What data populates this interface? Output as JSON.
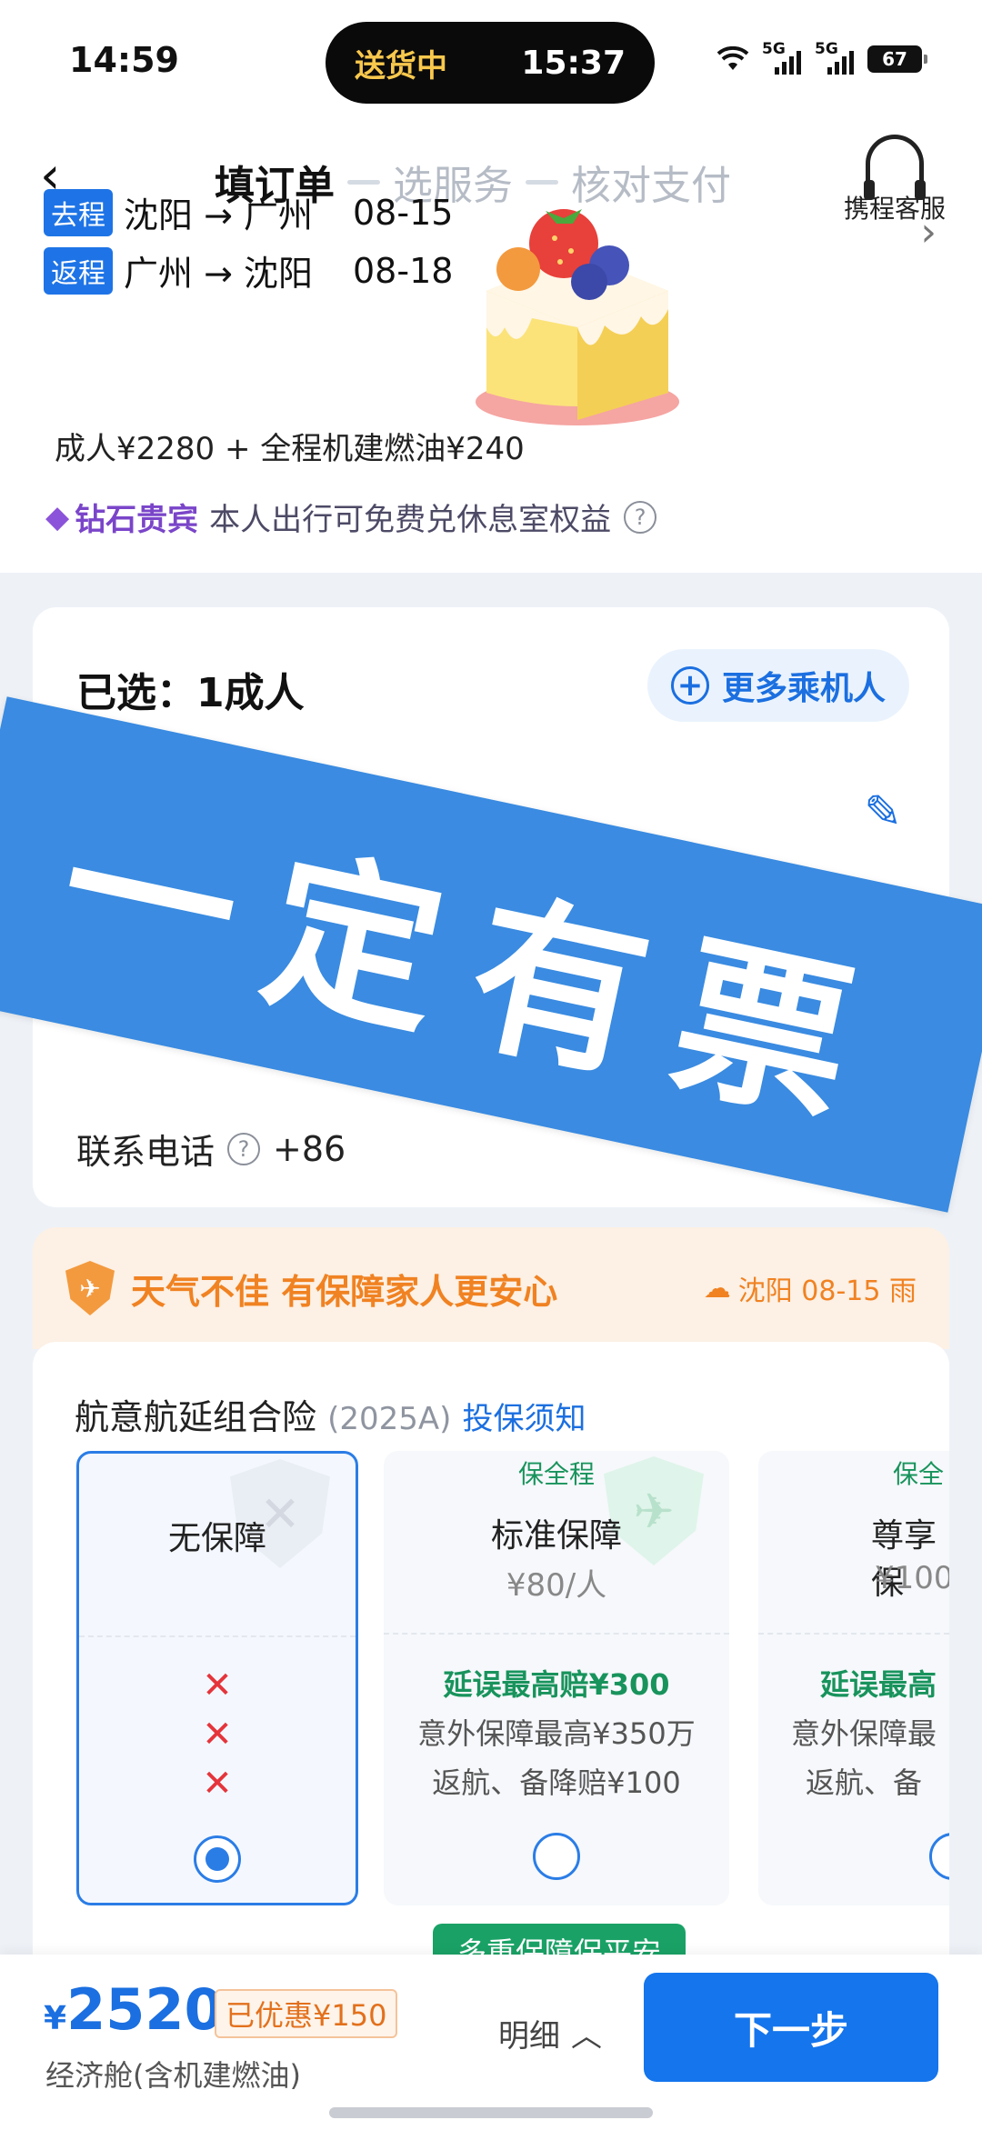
{
  "status_bar": {
    "time": "14:59",
    "island_label": "送货中",
    "island_time": "15:37",
    "battery": "67"
  },
  "header": {
    "steps": [
      "填订单",
      "选服务",
      "核对支付"
    ],
    "service_label": "携程客服"
  },
  "trips": [
    {
      "tag": "去程",
      "route": "沈阳 → 广州",
      "date": "08-15"
    },
    {
      "tag": "返程",
      "route": "广州 → 沈阳",
      "date": "08-18"
    }
  ],
  "price_line": "成人¥2280 + 全程机建燃油¥240",
  "vip": {
    "level": "钻石贵宾",
    "text": "本人出行可免费兑休息室权益"
  },
  "passenger": {
    "selected": "已选：1成人",
    "more_button": "更多乘机人",
    "phone_label": "联系电话",
    "phone_prefix": "+86"
  },
  "stamp_text": "一定有票",
  "weather": {
    "text": "天气不佳 有保障家人更安心",
    "right": "沈阳 08-15 雨"
  },
  "insurance": {
    "title": "航意航延组合险",
    "year": "(2025A)",
    "link": "投保须知",
    "options": [
      {
        "tag": "",
        "name": "无保障",
        "price": "",
        "lines": [
          "✕",
          "✕",
          "✕"
        ],
        "selected": true
      },
      {
        "tag": "保全程",
        "name": "标准保障",
        "price": "¥80/人",
        "lines": [
          "延误最高赔¥300",
          "意外保障最高¥350万",
          "返航、备降赔¥100"
        ],
        "selected": false
      },
      {
        "tag": "保全",
        "name": "尊享保",
        "price": "¥100",
        "lines": [
          "延误最高",
          "意外保障最",
          "返航、备"
        ],
        "selected": false
      }
    ],
    "ribbon": "多重保障保平安"
  },
  "bottom": {
    "currency": "¥",
    "amount": "2520",
    "discount": "已优惠¥150",
    "cabin": "经济舱(含机建燃油)",
    "detail": "明细",
    "next": "下一步"
  },
  "colors": {
    "accent": "#1475ed",
    "stamp": "#3a8be1",
    "warning": "#f08222",
    "green": "#18935c",
    "vip": "#7a45c9"
  }
}
